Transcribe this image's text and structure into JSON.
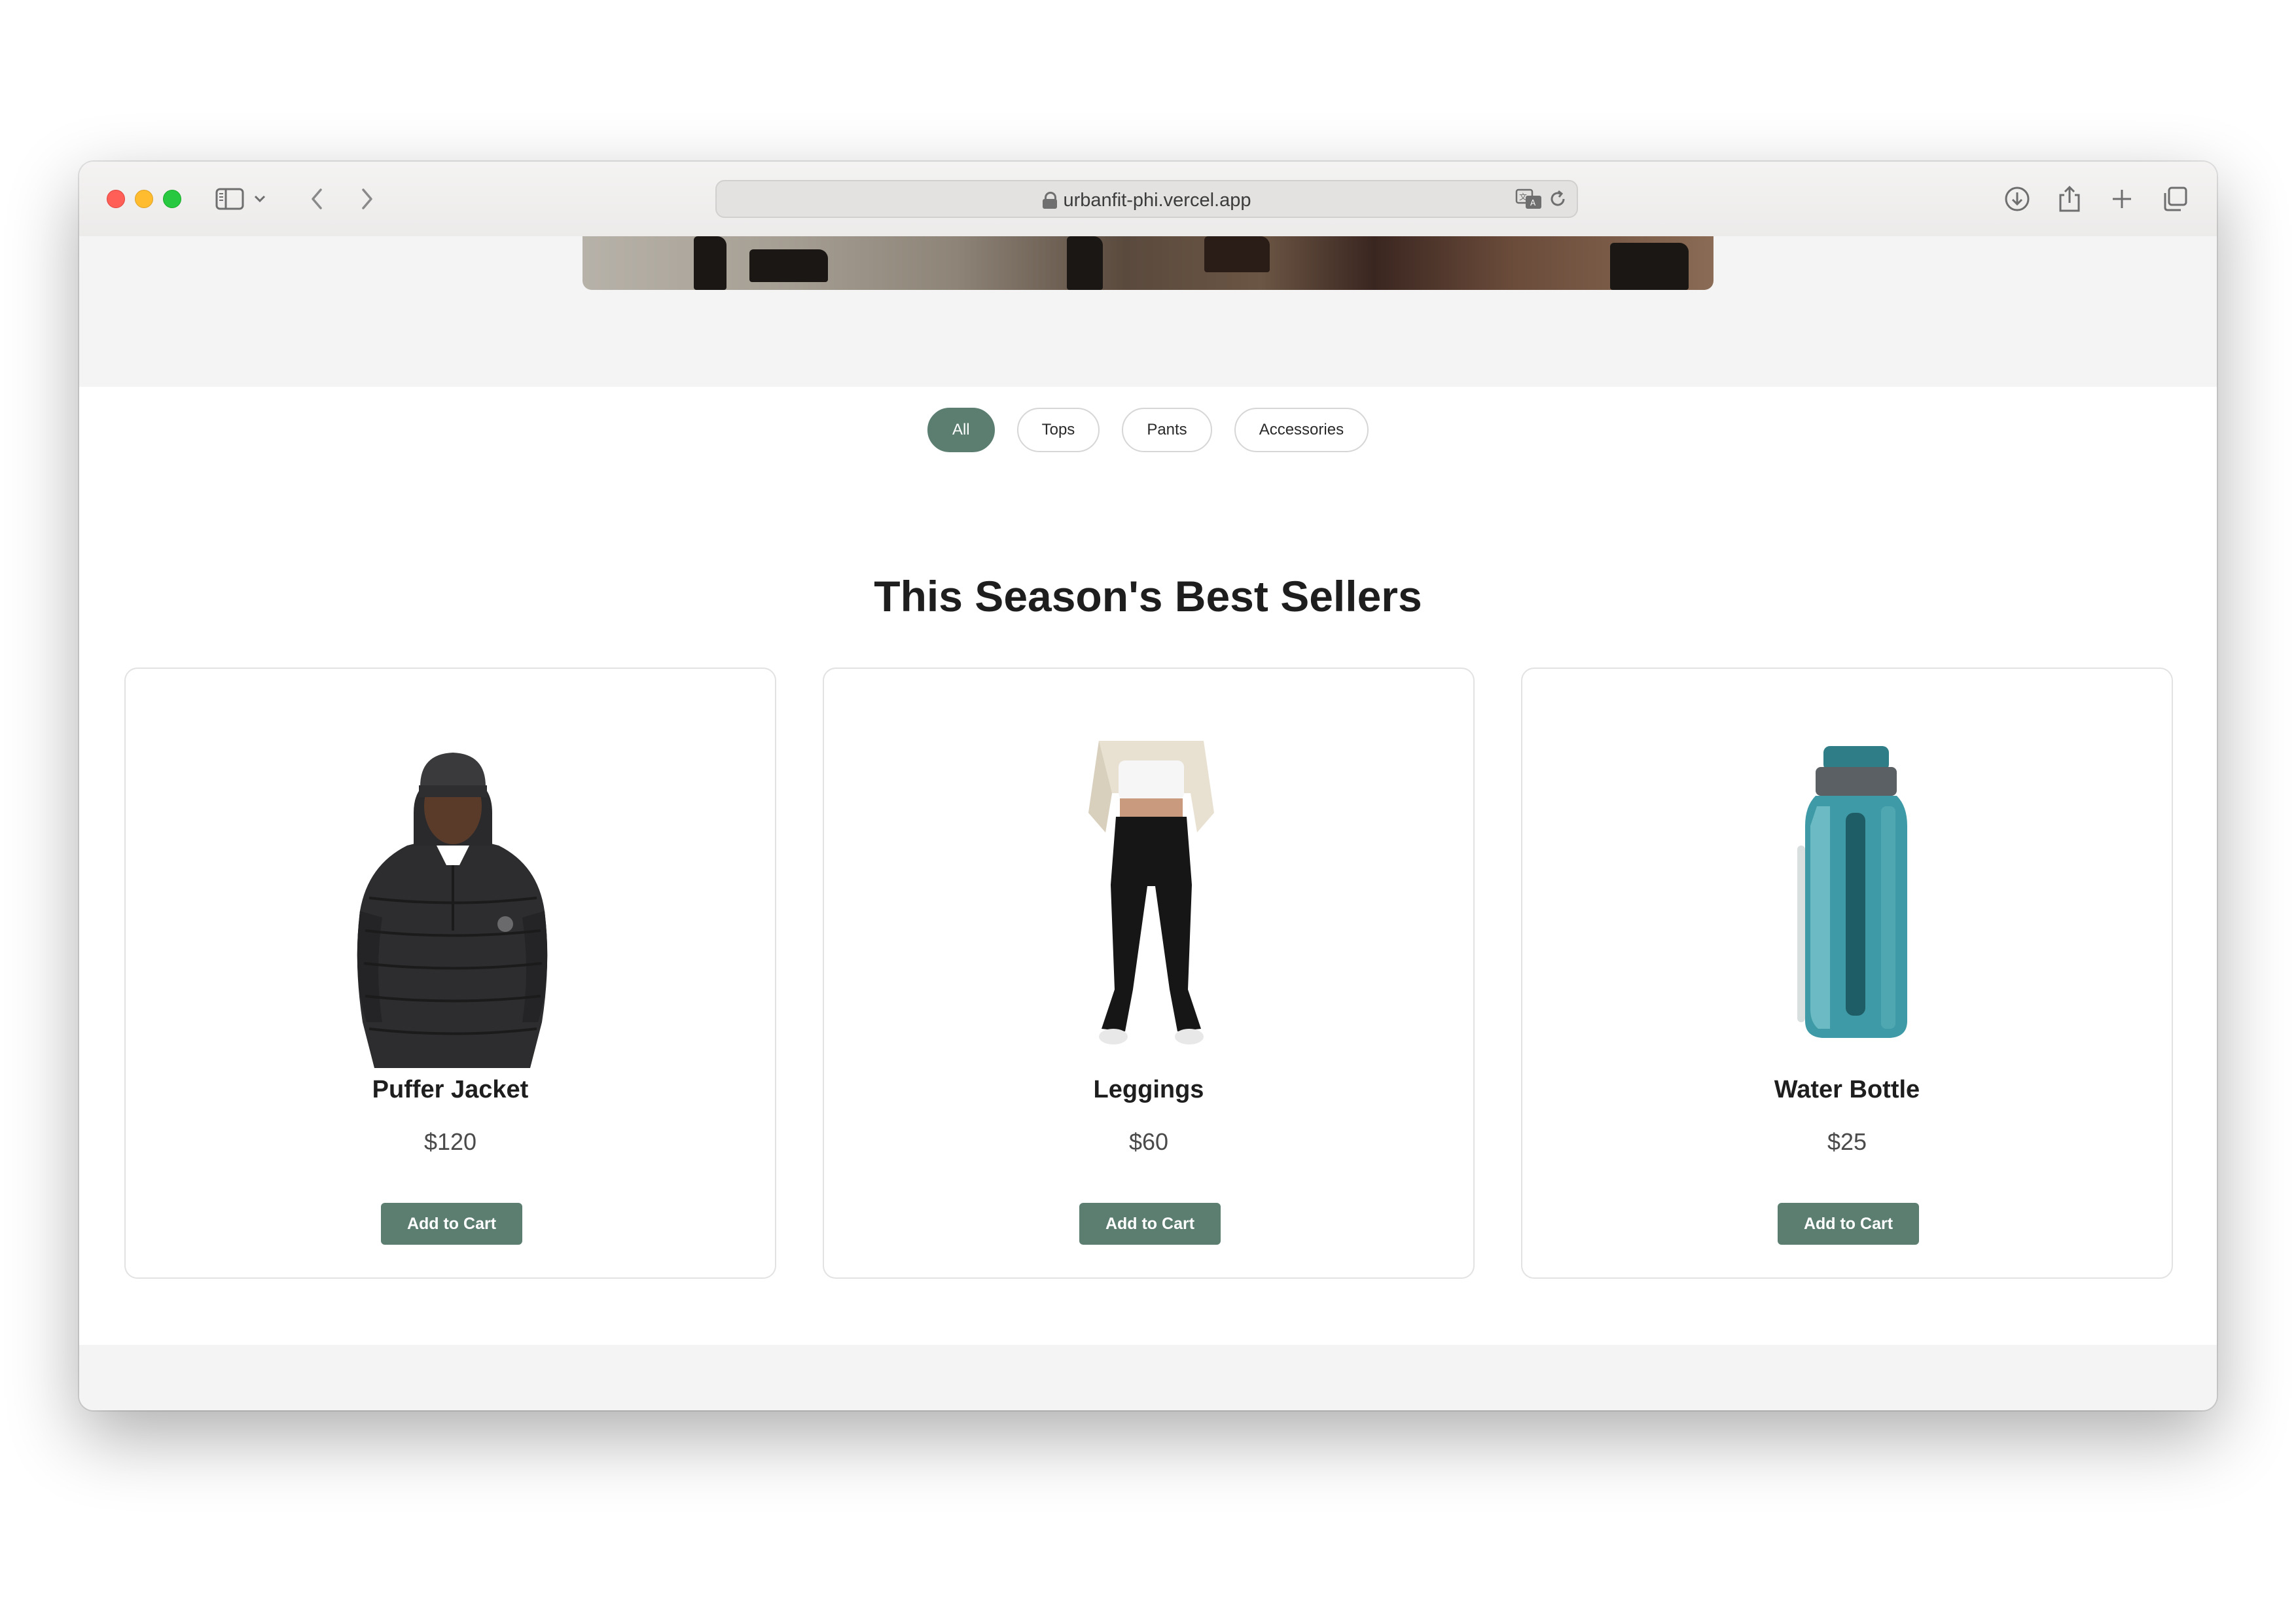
{
  "browser": {
    "url": "urbanfit-phi.vercel.app",
    "icons": [
      "sidebar-icon",
      "chevron-down-icon",
      "back-icon",
      "forward-icon",
      "lock-icon",
      "translate-icon",
      "reload-icon",
      "download-icon",
      "share-icon",
      "new-tab-icon",
      "tabs-overview-icon"
    ]
  },
  "filters": [
    {
      "label": "All",
      "active": true
    },
    {
      "label": "Tops",
      "active": false
    },
    {
      "label": "Pants",
      "active": false
    },
    {
      "label": "Accessories",
      "active": false
    }
  ],
  "section_title": "This Season's Best Sellers",
  "products": [
    {
      "name": "Puffer Jacket",
      "price": "$120",
      "button": "Add to Cart"
    },
    {
      "name": "Leggings",
      "price": "$60",
      "button": "Add to Cart"
    },
    {
      "name": "Water Bottle",
      "price": "$25",
      "button": "Add to Cart"
    }
  ],
  "colors": {
    "accent": "#5b7e71",
    "hero_band": "#f4f4f4"
  }
}
